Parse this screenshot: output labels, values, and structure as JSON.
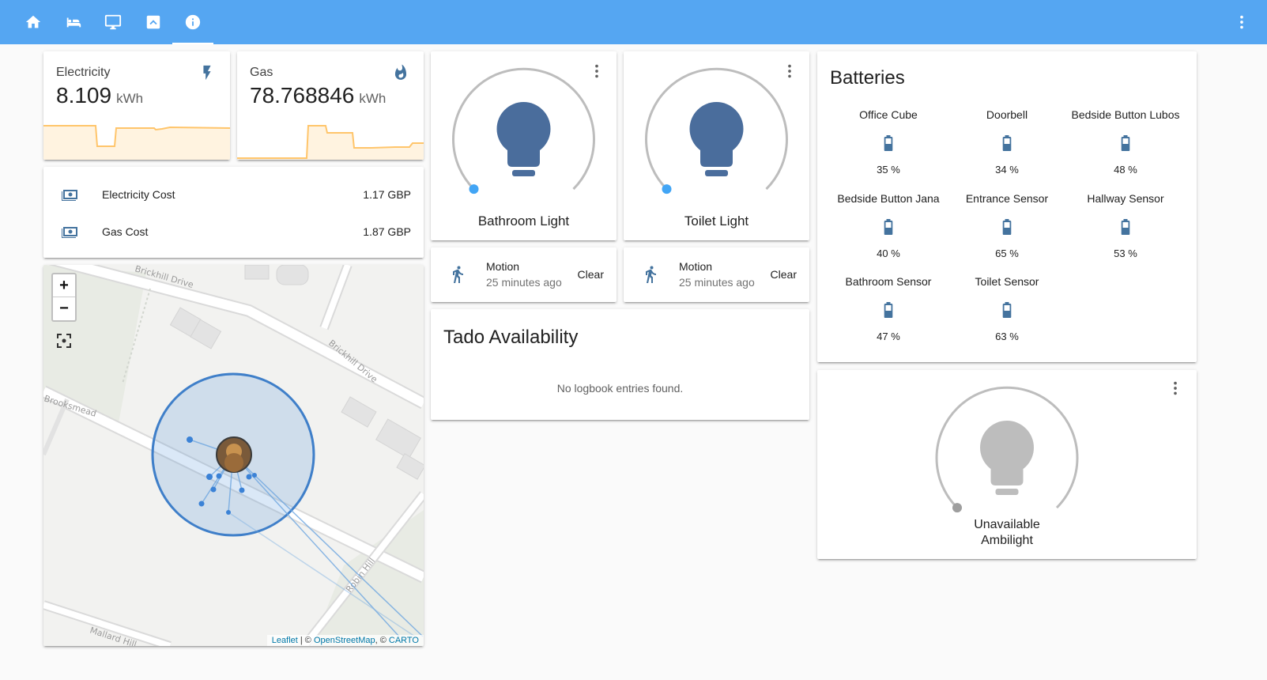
{
  "tabs": [
    {
      "name": "home-icon",
      "active": false
    },
    {
      "name": "bed-icon",
      "active": false
    },
    {
      "name": "monitor-icon",
      "active": false
    },
    {
      "name": "image-icon",
      "active": false
    },
    {
      "name": "info-icon",
      "active": true
    }
  ],
  "sensors": {
    "electricity": {
      "name": "Electricity",
      "value": "8.109",
      "unit": "kWh",
      "icon": "flash-icon"
    },
    "gas": {
      "name": "Gas",
      "value": "78.768846",
      "unit": "kWh",
      "icon": "fire-icon"
    }
  },
  "costs": [
    {
      "name": "Electricity Cost",
      "value": "1.17 GBP",
      "icon": "cash-icon"
    },
    {
      "name": "Gas Cost",
      "value": "1.87 GBP",
      "icon": "cash-icon"
    }
  ],
  "map": {
    "zoom_in": "+",
    "zoom_out": "−",
    "streets": [
      "Brickhill Drive",
      "Brickhill Drive",
      "Brooksmead",
      "Robin Hill",
      "Mallard Hill"
    ],
    "attribution": {
      "leaflet": "Leaflet",
      "sep1": " | © ",
      "osm": "OpenStreetMap",
      "sep2": ", © ",
      "carto": "CARTO"
    }
  },
  "lights": [
    {
      "name": "Bathroom Light",
      "state": "on"
    },
    {
      "name": "Toilet Light",
      "state": "on"
    }
  ],
  "motion": [
    {
      "name": "Motion",
      "time": "25 minutes ago",
      "state": "Clear"
    },
    {
      "name": "Motion",
      "time": "25 minutes ago",
      "state": "Clear"
    }
  ],
  "logbook": {
    "title": "Tado Availability",
    "empty": "No logbook entries found."
  },
  "batteries": {
    "title": "Batteries",
    "items": [
      {
        "name": "Office Cube",
        "value": "35 %"
      },
      {
        "name": "Doorbell",
        "value": "34 %"
      },
      {
        "name": "Bedside Button Lubos",
        "value": "48 %"
      },
      {
        "name": "Bedside Button Jana",
        "value": "40 %"
      },
      {
        "name": "Entrance Sensor",
        "value": "65 %"
      },
      {
        "name": "Hallway Sensor",
        "value": "53 %"
      },
      {
        "name": "Bathroom Sensor",
        "value": "47 %"
      },
      {
        "name": "Toilet Sensor",
        "value": "63 %"
      }
    ]
  },
  "ambilight": {
    "state": "Unavailable",
    "name": "Ambilight"
  },
  "colors": {
    "header": "#55a6f2",
    "icon": "#44739e",
    "light_on": "#4a6d9c",
    "light_off": "#bdbdbd",
    "spark": "#ffc56b"
  }
}
